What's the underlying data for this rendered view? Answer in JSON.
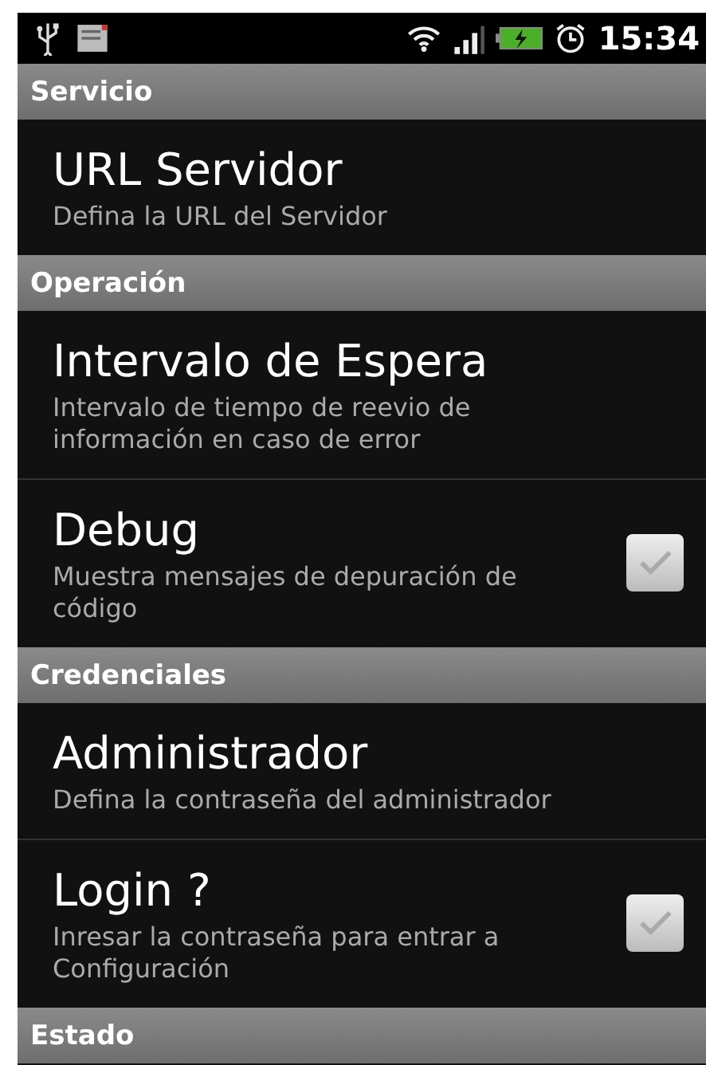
{
  "status_bar": {
    "time": "15:34"
  },
  "sections": [
    {
      "header": "Servicio",
      "items": [
        {
          "kind": "plain",
          "title": "URL Servidor",
          "summary": "Defina la URL del Servidor"
        }
      ]
    },
    {
      "header": "Operación",
      "items": [
        {
          "kind": "plain",
          "title": "Intervalo de Espera",
          "summary": "Intervalo de tiempo de reevio de información en caso de error"
        },
        {
          "kind": "checkbox",
          "title": "Debug",
          "summary": "Muestra mensajes de depuración de código",
          "checked": false
        }
      ]
    },
    {
      "header": "Credenciales",
      "items": [
        {
          "kind": "plain",
          "title": "Administrador",
          "summary": "Defina la contraseña del administrador"
        },
        {
          "kind": "checkbox",
          "title": "Login ?",
          "summary": "Inresar la contraseña para entrar a Configuración",
          "checked": false
        }
      ]
    },
    {
      "header": "Estado"
    }
  ]
}
